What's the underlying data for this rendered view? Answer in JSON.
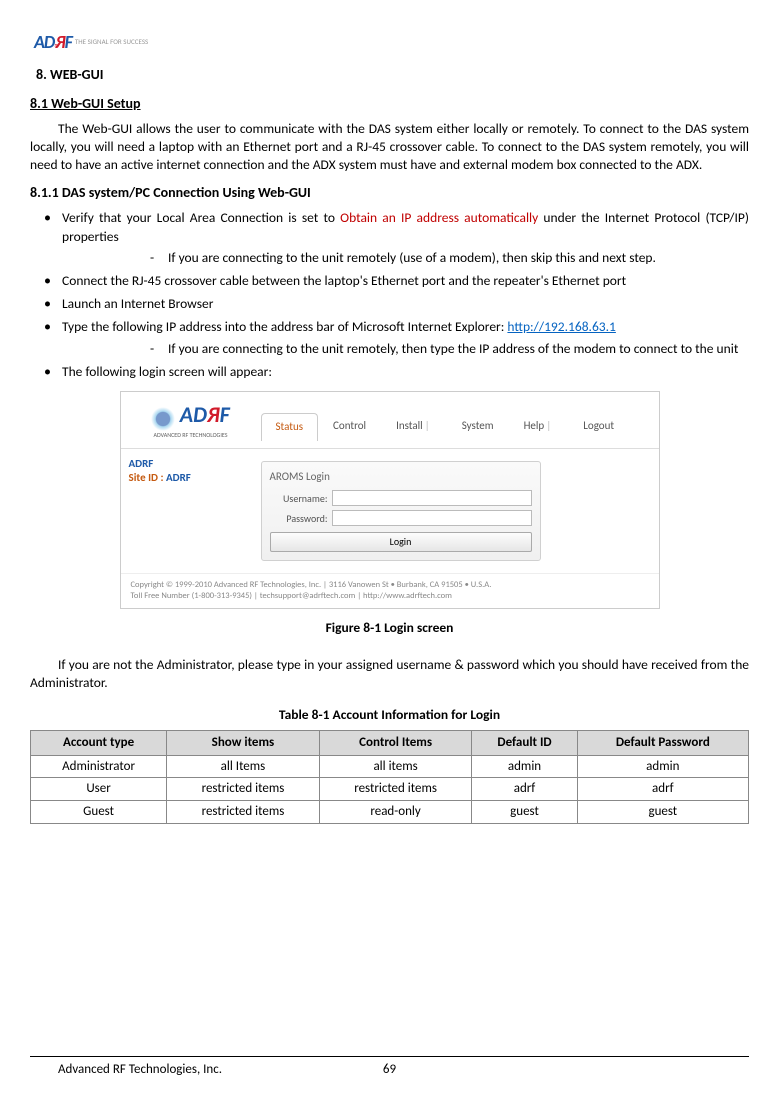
{
  "logo": {
    "tagline": "THE SIGNAL FOR SUCCESS"
  },
  "h1": "8.    WEB-GUI",
  "h2": "8.1  Web-GUI Setup",
  "p1": "The Web-GUI allows the user to communicate with the DAS system either locally or remotely.  To connect to the DAS system locally, you will need a laptop with an Ethernet port and a RJ-45 crossover cable.  To connect to the DAS system remotely, you will need to have an active internet connection and the ADX system must have and external modem box connected to the ADX.",
  "h3": "8.1.1      DAS system/PC Connection Using Web-GUI",
  "b1a": "Verify that your Local Area Connection is set to ",
  "b1red": "Obtain an IP address automatically",
  "b1b": " under the Internet Protocol (TCP/IP) properties",
  "s1": "If you are connecting to the unit remotely (use of a modem), then skip this and next step.",
  "b2": "Connect the RJ-45 crossover cable between the laptop's Ethernet port and the repeater's Ethernet port",
  "b3": "Launch an Internet Browser",
  "b4a": "Type the following IP address into the address bar of Microsoft Internet Explorer: ",
  "b4link": "http://192.168.63.1",
  "s2": "If you are connecting to the unit remotely, then type the IP address of the modem to connect to the unit",
  "b5": "The following login screen will appear:",
  "mock": {
    "logo_sub": "ADVANCED RF TECHNOLOGIES",
    "tabs": [
      "Status",
      "Control",
      "Install",
      "System",
      "Help",
      "Logout"
    ],
    "sidebar_l1": "ADRF",
    "sidebar_l2_a": "Site ID : ",
    "sidebar_l2_b": "ADRF",
    "panel_title": "AROMS Login",
    "lbl_user": "Username:",
    "lbl_pass": "Password:",
    "btn_login": "Login",
    "footer1": "Copyright © 1999-2010 Advanced RF Technologies, Inc. | 3116 Vanowen St • Burbank, CA 91505 • U.S.A.",
    "footer2": "Toll Free Number (1-800-313-9345) | techsupport@adrftech.com | http://www.adrftech.com"
  },
  "fig_caption": "Figure 8-1     Login screen",
  "p2": "If you are not the Administrator, please type in your assigned username & password which you should have received from the Administrator.",
  "tbl_caption": "Table 8-1      Account Information for Login",
  "tbl": {
    "head": [
      "Account type",
      "Show items",
      "Control Items",
      "Default ID",
      "Default Password"
    ],
    "rows": [
      [
        "Administrator",
        "all Items",
        "all items",
        "admin",
        "admin"
      ],
      [
        "User",
        "restricted items",
        "restricted items",
        "adrf",
        "adrf"
      ],
      [
        "Guest",
        "restricted items",
        "read-only",
        "guest",
        "guest"
      ]
    ]
  },
  "footer_company": "Advanced RF Technologies, Inc.",
  "footer_page": "69"
}
